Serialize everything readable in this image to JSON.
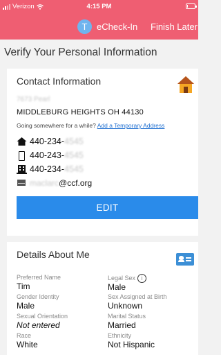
{
  "status_bar": {
    "carrier": "Verizon",
    "time": "4:15 PM",
    "battery_level": 0.12
  },
  "app_bar": {
    "logo_letter": "T",
    "title": "eCheck-In",
    "finish_label": "Finish Later"
  },
  "page": {
    "title": "Verify Your Personal Information"
  },
  "contact": {
    "title": "Contact Information",
    "street_redacted": "7673 Pearl",
    "city_line": "MIDDLEBURG HEIGHTS OH 44130",
    "temp_prompt": "Going somewhere for a while?",
    "temp_link": "Add a Temporary Address",
    "phones": [
      {
        "icon": "home-phone-icon",
        "prefix": "440-234-",
        "redacted": "4545"
      },
      {
        "icon": "mobile-phone-icon",
        "prefix": "440-243-",
        "redacted": "4545"
      },
      {
        "icon": "work-phone-icon",
        "prefix": "440-234-",
        "redacted": "4545"
      }
    ],
    "email": {
      "icon": "email-icon",
      "redacted": "maclarc",
      "domain": "@ccf.org"
    },
    "edit_label": "EDIT",
    "colors": {
      "edit_button": "#2a8bea",
      "link": "#1f6fd1"
    }
  },
  "details": {
    "title": "Details About Me",
    "fields": {
      "preferred_name": {
        "label": "Preferred Name",
        "value": "Tim"
      },
      "legal_sex": {
        "label": "Legal Sex",
        "value": "Male",
        "info_glyph": "i"
      },
      "gender_identity": {
        "label": "Gender Identity",
        "value": "Male"
      },
      "sex_at_birth": {
        "label": "Sex Assigned at Birth",
        "value": "Unknown"
      },
      "sexual_orientation": {
        "label": "Sexual Orientation",
        "value": "Not entered"
      },
      "marital_status": {
        "label": "Marital Status",
        "value": "Married"
      },
      "race": {
        "label": "Race",
        "value": "White"
      },
      "ethnicity": {
        "label": "Ethnicity",
        "value": "Not Hispanic"
      }
    }
  },
  "theme": {
    "accent": "#ef5e72",
    "background": "#f2f2f2"
  }
}
